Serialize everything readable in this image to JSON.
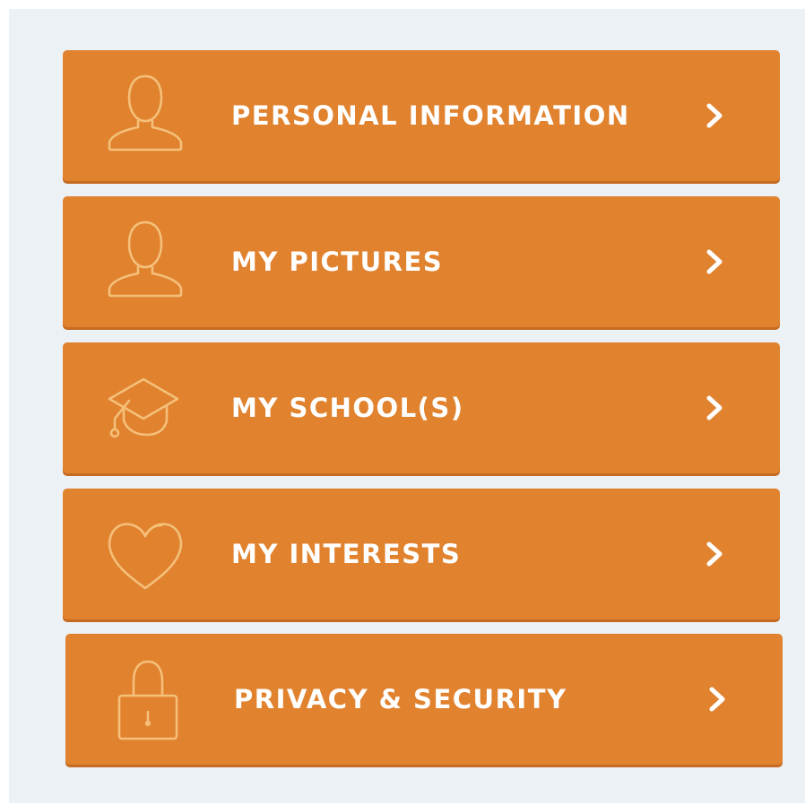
{
  "colors": {
    "background": "#ecf1f6",
    "item": "#e1822f",
    "item_shadow": "#c66c22",
    "icon_stroke": "#f4c07a",
    "text": "#ffffff"
  },
  "menu": {
    "items": [
      {
        "label": "PERSONAL INFORMATION",
        "icon": "user-icon"
      },
      {
        "label": "MY PICTURES",
        "icon": "user-icon"
      },
      {
        "label": "MY SCHOOL(S)",
        "icon": "graduation-cap-icon"
      },
      {
        "label": "MY INTERESTS",
        "icon": "heart-icon"
      },
      {
        "label": "PRIVACY & SECURITY",
        "icon": "lock-icon"
      }
    ]
  }
}
